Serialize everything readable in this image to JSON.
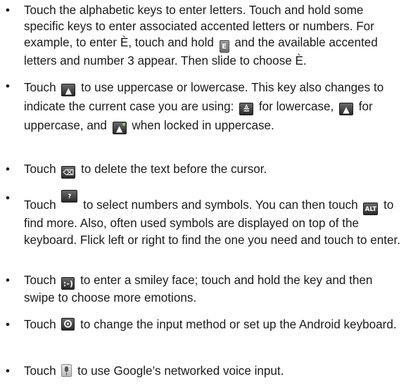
{
  "bullets": [
    {
      "symbol": "•",
      "text": [
        "Touch the alphabetic keys to enter letters. Touch and hold some specific keys to enter associated accented letters or numbers. For example, to enter È, touch and hold ",
        " and the available accented letters and number 3 appear. Then slide to choose È."
      ]
    },
    {
      "symbol": "•",
      "text": [
        "Touch ",
        " to use uppercase or lowercase. This key also changes to indicate the current case you are using: ",
        " for lowercase, ",
        " for uppercase, and ",
        " when locked in uppercase."
      ]
    },
    {
      "symbol": "•",
      "text": [
        "Touch ",
        " to delete the text before the cursor."
      ]
    },
    {
      "symbol": "•",
      "text": [
        "Touch ",
        " to select numbers and symbols. You can then touch ",
        " to find more. Also, often used symbols are displayed on top of the keyboard. Flick left or right to find the one you need and touch to enter."
      ]
    },
    {
      "symbol": "•",
      "text": [
        "Touch ",
        " to enter a smiley face; touch and hold the key and then swipe to choose more emotions."
      ]
    },
    {
      "symbol": "•",
      "text": [
        "Touch ",
        " to change the input method or set up the Android keyboard."
      ]
    },
    {
      "symbol": "•",
      "text": [
        "Touch ",
        " to use Google’s networked voice input."
      ]
    }
  ],
  "keys": {
    "e_key": "E",
    "shift_key": "▲",
    "shift_lower_key": "≜",
    "delete_key": "⌫",
    "numbers_key": "?123",
    "alt_key": "ALT",
    "smiley_key": ":-)",
    "settings_key": "settings-gear-icon",
    "mic_key": "microphone-icon"
  }
}
